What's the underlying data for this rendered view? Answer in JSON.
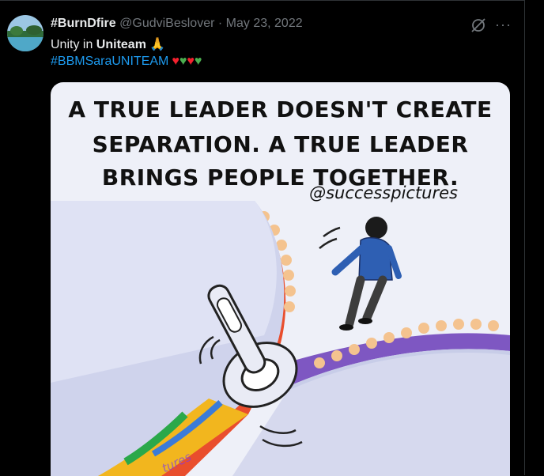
{
  "tweet": {
    "display_name": "#BurnDfire",
    "handle": "@GudviBeslover",
    "separator": "·",
    "date": "May 23, 2022",
    "text_plain": "Unity in ",
    "text_bold": "Uniteam",
    "text_emoji": "🙏",
    "hashtag": "#BBMSaraUNITEAM",
    "hearts": "♥♥♥♥",
    "more_label": "···"
  },
  "media": {
    "quote_line1": "A TRUE LEADER DOESN'T CREATE",
    "quote_line2": "SEPARATION. A TRUE LEADER",
    "quote_line3": "BRINGS PEOPLE TOGETHER.",
    "credit": "@successpictures",
    "watermark": "tures"
  },
  "colors": {
    "link": "#1d9bf0",
    "heart_red": "#f91880",
    "heart_green": "#00ba7c",
    "secondary_text": "#71767b"
  },
  "icons": [
    "grok-icon",
    "more-icon"
  ]
}
